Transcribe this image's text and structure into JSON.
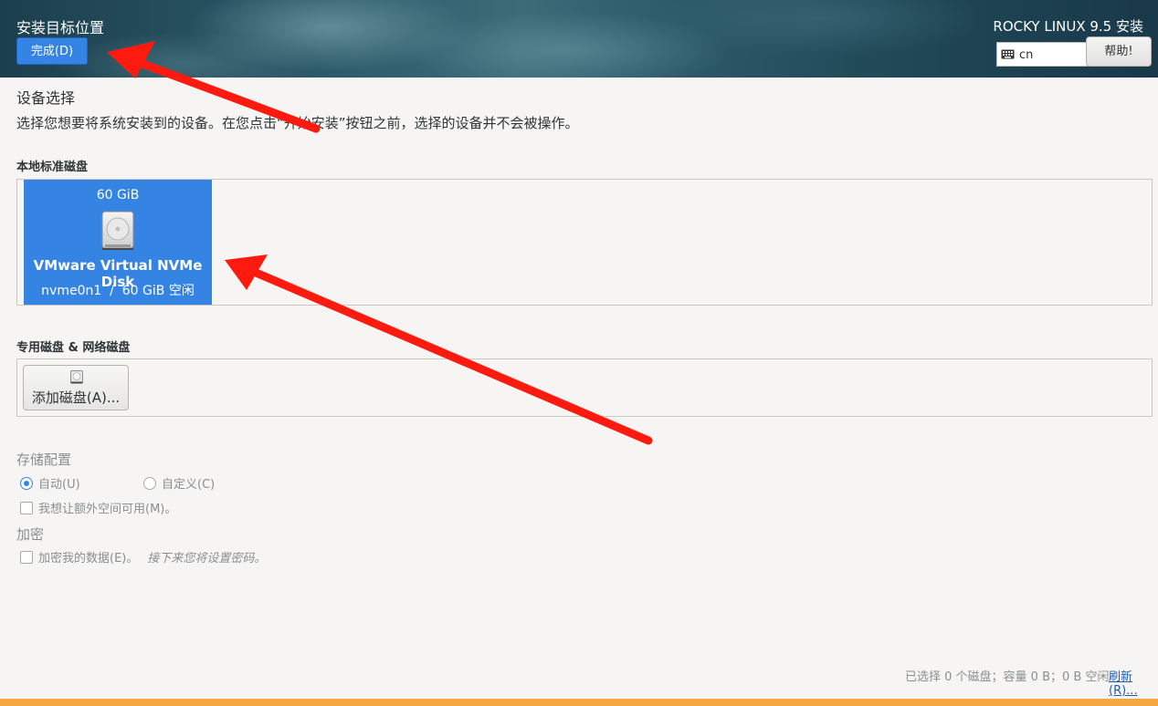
{
  "header": {
    "title": "安装目标位置",
    "done_label": "完成(D)",
    "product": "ROCKY LINUX 9.5 安装",
    "keyboard_layout": "cn",
    "help_label": "帮助!"
  },
  "device_selection": {
    "title": "设备选择",
    "description": "选择您想要将系统安装到的设备。在您点击“开始安装”按钮之前，选择的设备并不会被操作。"
  },
  "local_disks": {
    "label": "本地标准磁盘",
    "disks": [
      {
        "size": "60 GiB",
        "name": "VMware Virtual NVMe Disk",
        "detail": "nvme0n1  /  60 GiB 空闲",
        "selected": true
      }
    ]
  },
  "special_disks": {
    "label": "专用磁盘 & 网络磁盘",
    "add_label": "添加磁盘(A)..."
  },
  "storage_config": {
    "title": "存储配置",
    "auto_label": "自动(U)",
    "custom_label": "自定义(C)",
    "selected": "auto",
    "extra_space_label": "我想让额外空间可用(M)。"
  },
  "encryption": {
    "title": "加密",
    "encrypt_label": "加密我的数据(E)。",
    "encrypt_hint": "接下来您将设置密码。"
  },
  "footer": {
    "status": "已选择 0 个磁盘；容量 0 B；0 B 空闲",
    "refresh_label": "刷新(R)..."
  },
  "colors": {
    "accent": "#3584e4",
    "annotation_arrow": "#ff1a10",
    "bottom_bar": "#f5a742"
  }
}
